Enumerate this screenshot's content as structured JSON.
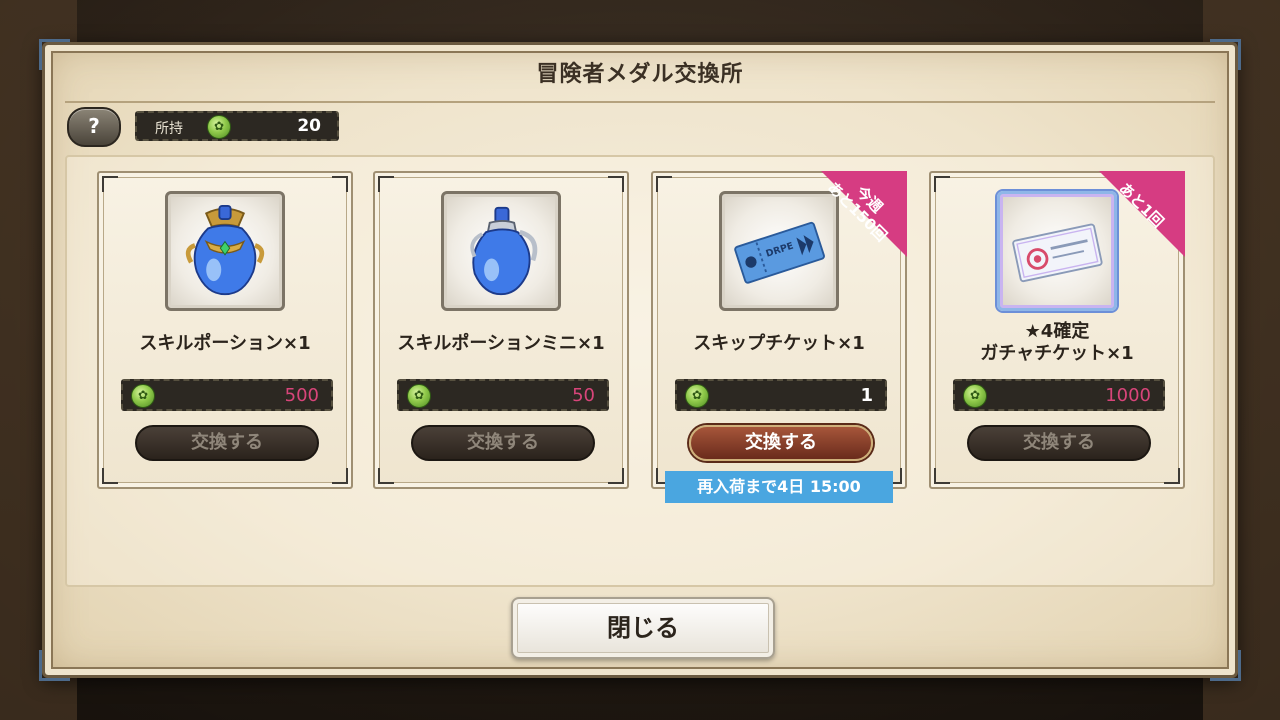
{
  "dialog": {
    "title": "冒険者メダル交換所"
  },
  "header": {
    "help_label": "?",
    "owned_label": "所持",
    "owned_value": "20",
    "medal_icon": "medal-icon"
  },
  "items": [
    {
      "name": "スキルポーション×1",
      "price": "500",
      "button": "交換する",
      "icon": "skill-potion-icon"
    },
    {
      "name": "スキルポーションミニ×1",
      "price": "50",
      "button": "交換する",
      "icon": "skill-potion-mini-icon"
    },
    {
      "name": "スキップチケット×1",
      "price": "1",
      "button": "交換する",
      "icon": "skip-ticket-icon",
      "ribbon_line1": "今週",
      "ribbon_line2": "あと150回",
      "restock": "再入荷まで4日 15:00"
    },
    {
      "name_line1": "★4確定",
      "name_line2": "ガチャチケット×1",
      "price": "1000",
      "button": "交換する",
      "icon": "gacha-ticket-icon",
      "ribbon_line1": "あと1回"
    }
  ],
  "footer": {
    "close_label": "閉じる"
  },
  "colors": {
    "ribbon": "#d63c82",
    "price_unaffordable": "#d8457a",
    "restock_banner": "#4aa6e0"
  }
}
